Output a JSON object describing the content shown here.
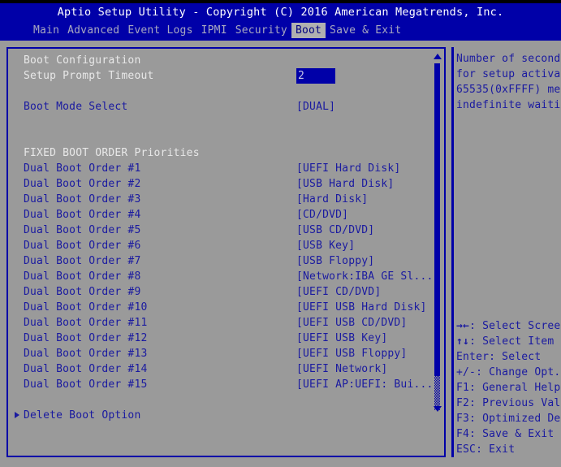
{
  "header": {
    "title": "Aptio Setup Utility - Copyright (C) 2016 American Megatrends, Inc.",
    "tabs": [
      {
        "label": "Main",
        "active": false
      },
      {
        "label": "Advanced",
        "active": false
      },
      {
        "label": "Event Logs",
        "active": false
      },
      {
        "label": "IPMI",
        "active": false
      },
      {
        "label": "Security",
        "active": false
      },
      {
        "label": "Boot",
        "active": true
      },
      {
        "label": "Save & Exit",
        "active": false
      }
    ]
  },
  "main": {
    "section_title": "Boot Configuration",
    "setup_prompt_timeout": {
      "label": "Setup Prompt Timeout",
      "value": "2"
    },
    "boot_mode_select": {
      "label": "Boot Mode Select",
      "value": "[DUAL]"
    },
    "fixed_boot_order_title": "FIXED BOOT ORDER Priorities",
    "boot_orders": [
      {
        "label": "Dual Boot Order #1",
        "value": "[UEFI Hard Disk]"
      },
      {
        "label": "Dual Boot Order #2",
        "value": "[USB Hard Disk]"
      },
      {
        "label": "Dual Boot Order #3",
        "value": "[Hard Disk]"
      },
      {
        "label": "Dual Boot Order #4",
        "value": "[CD/DVD]"
      },
      {
        "label": "Dual Boot Order #5",
        "value": "[USB CD/DVD]"
      },
      {
        "label": "Dual Boot Order #6",
        "value": "[USB Key]"
      },
      {
        "label": "Dual Boot Order #7",
        "value": "[USB Floppy]"
      },
      {
        "label": "Dual Boot Order #8",
        "value": "[Network:IBA GE Sl...]"
      },
      {
        "label": "Dual Boot Order #9",
        "value": "[UEFI CD/DVD]"
      },
      {
        "label": "Dual Boot Order #10",
        "value": "[UEFI USB Hard Disk]"
      },
      {
        "label": "Dual Boot Order #11",
        "value": "[UEFI USB CD/DVD]"
      },
      {
        "label": "Dual Boot Order #12",
        "value": "[UEFI USB Key]"
      },
      {
        "label": "Dual Boot Order #13",
        "value": "[UEFI USB Floppy]"
      },
      {
        "label": "Dual Boot Order #14",
        "value": "[UEFI Network]"
      },
      {
        "label": "Dual Boot Order #15",
        "value": "[UEFI AP:UEFI: Bui...]"
      }
    ],
    "delete_boot_option": "Delete Boot Option"
  },
  "help": {
    "lines": [
      "Number of second",
      "for setup activa",
      "65535(0xFFFF) me",
      "indefinite waiti"
    ]
  },
  "keys": [
    {
      "glyph": "→←",
      "text": ": Select Scree"
    },
    {
      "glyph": "↑↓",
      "text": ": Select Item"
    },
    {
      "glyph": "",
      "text": "Enter: Select"
    },
    {
      "glyph": "",
      "text": "+/-: Change Opt."
    },
    {
      "glyph": "",
      "text": "F1: General Help"
    },
    {
      "glyph": "",
      "text": "F2: Previous Val"
    },
    {
      "glyph": "",
      "text": "F3: Optimized De"
    },
    {
      "glyph": "",
      "text": "F4: Save & Exit"
    },
    {
      "glyph": "",
      "text": "ESC: Exit"
    }
  ],
  "colors": {
    "header_blue": "#0000a8",
    "panel_gray": "#9a9a9a",
    "text_blue": "#1a1aa0",
    "text_white": "#e8e8e8",
    "tab_inactive": "#a8a8c0",
    "tab_active_bg": "#b0b0b0"
  }
}
